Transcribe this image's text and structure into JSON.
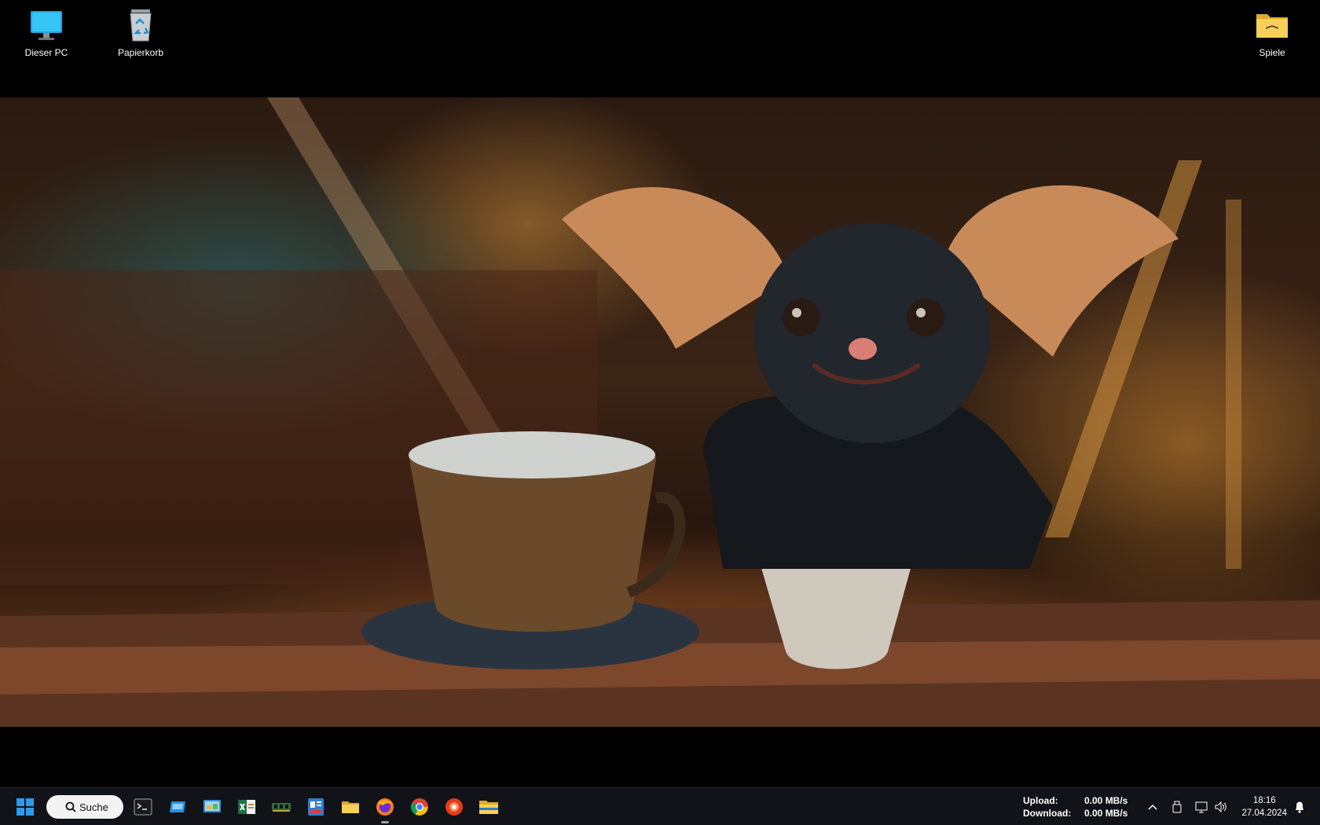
{
  "desktop_icons": [
    {
      "label": "Dieser PC",
      "icon": "computer-icon"
    },
    {
      "label": "Papierkorb",
      "icon": "recycle-bin-icon"
    },
    {
      "label": "Spiele",
      "icon": "folder-icon"
    }
  ],
  "wallpaper": {
    "icon": "wallpaper-image"
  },
  "taskbar": {
    "start_icon": "windows-start-icon",
    "search": {
      "label": "Suche",
      "icon": "search-icon"
    },
    "pinned_apps": [
      {
        "icon": "terminal-icon"
      },
      {
        "icon": "drive-app-icon"
      },
      {
        "icon": "control-panel-icon"
      },
      {
        "icon": "excel-app-icon"
      },
      {
        "icon": "memory-module-icon"
      },
      {
        "icon": "id-badge-icon"
      },
      {
        "icon": "file-explorer-icon"
      },
      {
        "icon": "firefox-icon"
      },
      {
        "icon": "chrome-icon"
      },
      {
        "icon": "red-app-icon"
      },
      {
        "icon": "file-explorer-icon"
      }
    ],
    "netspeed": {
      "upload_label": "Upload:",
      "upload_value": "0.00 MB/s",
      "download_label": "Download:",
      "download_value": "0.00 MB/s"
    },
    "tray_icons": [
      "chevron-up-icon",
      "usb-drive-icon",
      "network-icon",
      "volume-icon"
    ],
    "clock": {
      "time": "18:16",
      "date": "27.04.2024"
    },
    "notification_icon": "bell-icon"
  },
  "colors": {
    "taskbar_bg": "#111318",
    "accent": "#0078d4",
    "folder": "#f5c542"
  }
}
